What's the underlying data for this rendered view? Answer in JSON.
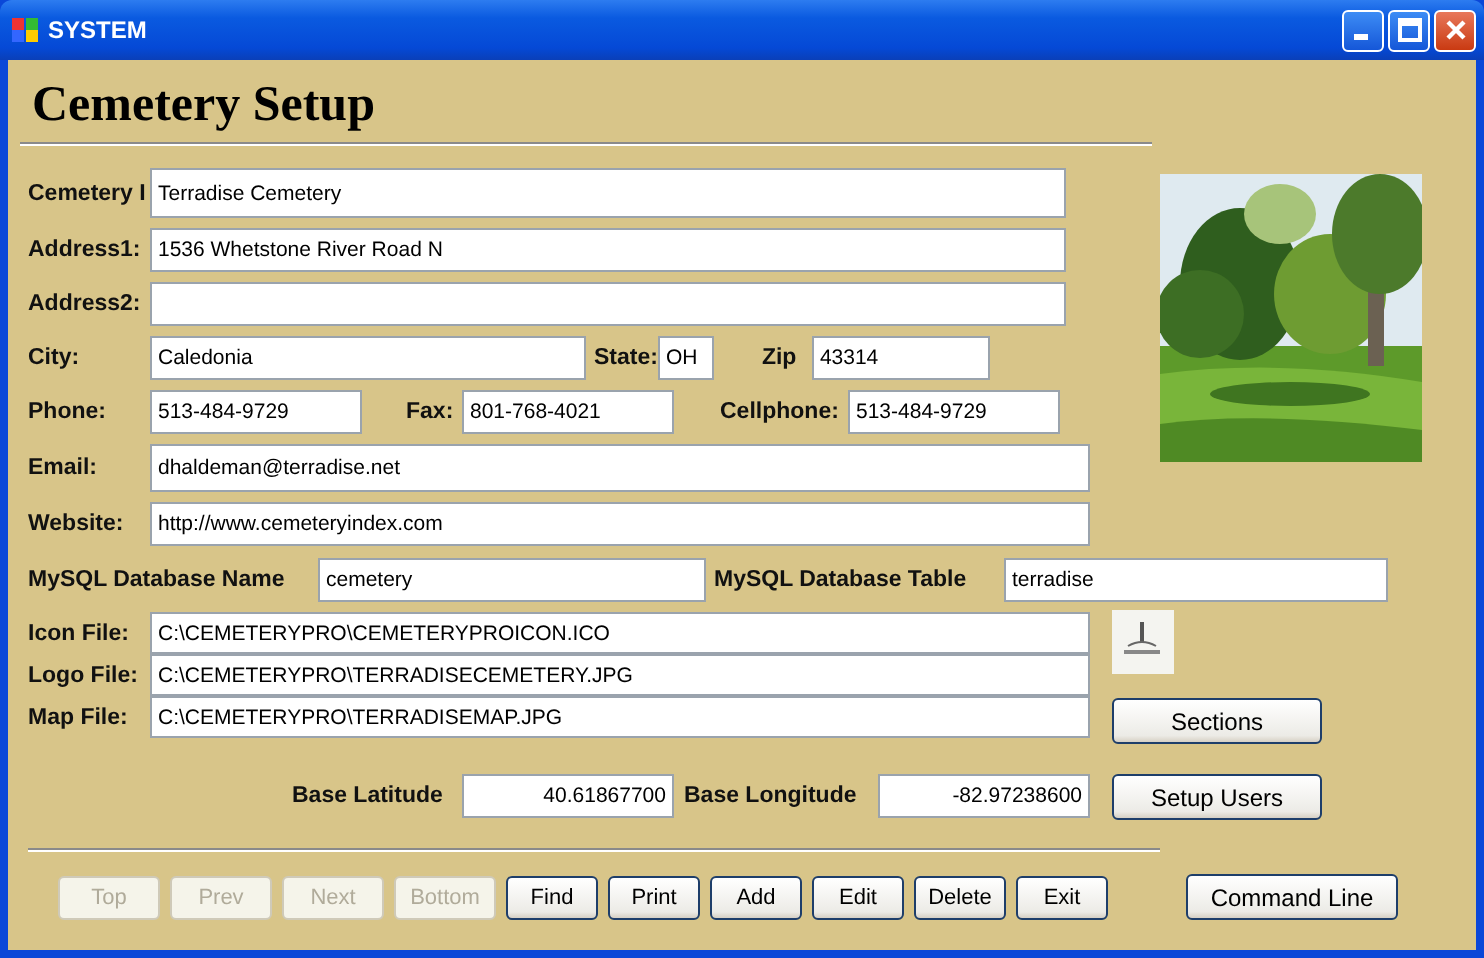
{
  "window": {
    "title": "SYSTEM"
  },
  "heading": "Cemetery Setup",
  "name": {
    "label": "Cemetery I",
    "value": "Terradise Cemetery"
  },
  "address1": {
    "label": "Address1:",
    "value": "1536 Whetstone River Road N"
  },
  "address2": {
    "label": "Address2:"
  },
  "city": {
    "label": "City:",
    "value": "Caledonia"
  },
  "state": {
    "label": "State:",
    "value": "OH"
  },
  "zip": {
    "label": "Zip",
    "value": "43314"
  },
  "phone": {
    "label": "Phone:",
    "value": "513-484-9729"
  },
  "fax": {
    "label": "Fax:",
    "value": "801-768-4021"
  },
  "cellphone": {
    "label": "Cellphone:",
    "value": "513-484-9729"
  },
  "email": {
    "label": "Email:",
    "value": "dhaldeman@terradise.net"
  },
  "website": {
    "label": "Website:",
    "value": "http://www.cemeteryindex.com"
  },
  "db_name": {
    "label": "MySQL Database Name",
    "value": "cemetery"
  },
  "db_table": {
    "label": "MySQL Database Table",
    "value": "terradise"
  },
  "files": [
    {
      "label": "Icon File:",
      "value": "C:\\CEMETERYPRO\\CEMETERYPROICON.ICO"
    },
    {
      "label": "Logo File:",
      "value": "C:\\CEMETERYPRO\\TERRADISECEMETERY.JPG"
    },
    {
      "label": "Map File:",
      "value": "C:\\CEMETERYPRO\\TERRADISEMAP.JPG"
    }
  ],
  "latitude": {
    "label": "Base Latitude",
    "value": "40.61867700"
  },
  "longitude": {
    "label": "Base Longitude",
    "value": "-82.97238600"
  },
  "side_buttons": [
    "Sections",
    "Setup Users"
  ],
  "nav_buttons": [
    {
      "label": "Top",
      "disabled": true
    },
    {
      "label": "Prev",
      "disabled": true
    },
    {
      "label": "Next",
      "disabled": true
    },
    {
      "label": "Bottom",
      "disabled": true
    },
    {
      "label": "Find",
      "disabled": false
    },
    {
      "label": "Print",
      "disabled": false
    },
    {
      "label": "Add",
      "disabled": false
    },
    {
      "label": "Edit",
      "disabled": false
    },
    {
      "label": "Delete",
      "disabled": false
    },
    {
      "label": "Exit",
      "disabled": false
    }
  ],
  "command_button": "Command Line"
}
